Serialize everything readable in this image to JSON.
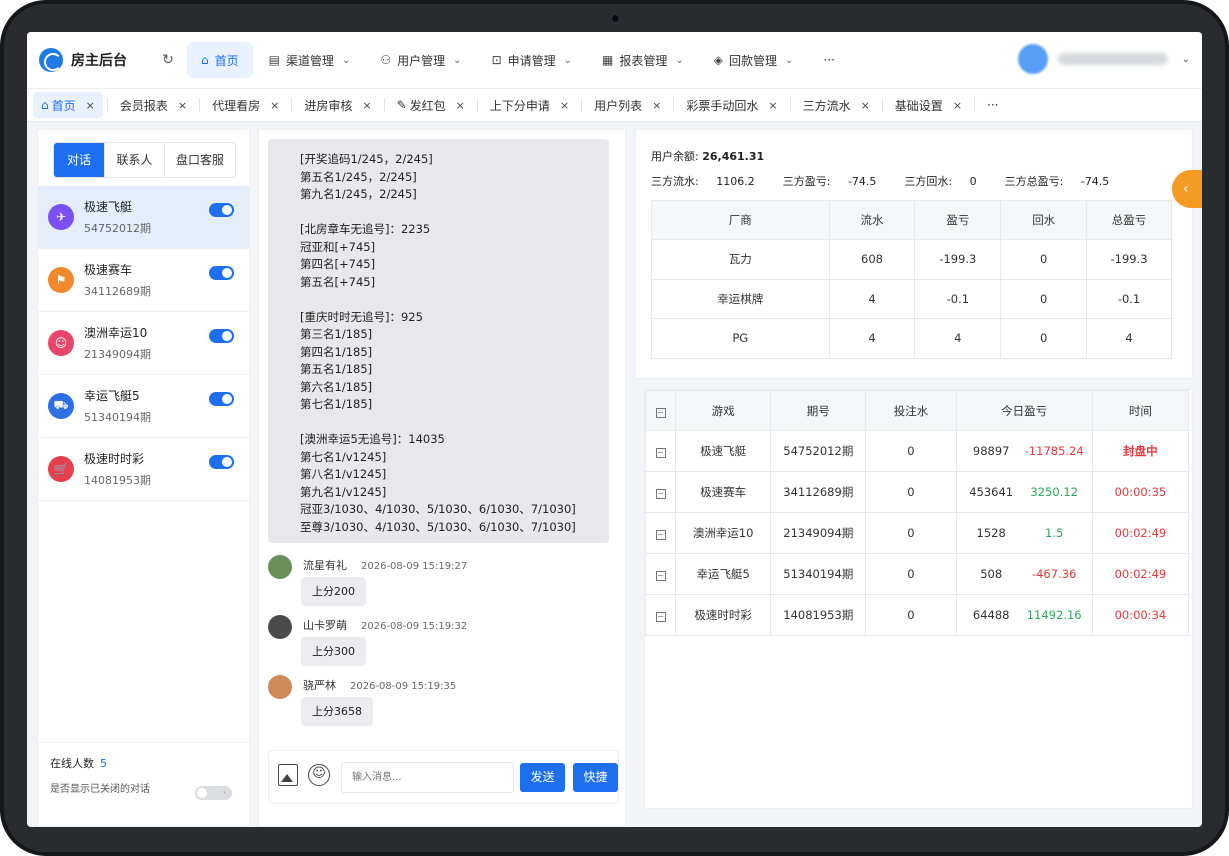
{
  "app": {
    "title": "房主后台",
    "refresh_icon": "refresh-icon"
  },
  "nav": {
    "items": [
      {
        "label": "首页",
        "icon": "home-icon",
        "active": true
      },
      {
        "label": "渠道管理",
        "icon": "channel-icon"
      },
      {
        "label": "用户管理",
        "icon": "users-icon"
      },
      {
        "label": "申请管理",
        "icon": "apply-icon"
      },
      {
        "label": "报表管理",
        "icon": "report-icon"
      },
      {
        "label": "回款管理",
        "icon": "payment-icon"
      }
    ],
    "more": "···"
  },
  "tabs": [
    {
      "label": "首页",
      "active": true
    },
    {
      "label": "会员报表"
    },
    {
      "label": "代理看房"
    },
    {
      "label": "进房审核"
    },
    {
      "label": "发红包"
    },
    {
      "label": "上下分申请"
    },
    {
      "label": "用户列表"
    },
    {
      "label": "彩票手动回水"
    },
    {
      "label": "三方流水"
    },
    {
      "label": "基础设置"
    }
  ],
  "tabs_more": "···",
  "close_glyph": "×",
  "sidebar": {
    "segments": [
      "对话",
      "联系人",
      "盘口客服"
    ],
    "games": [
      {
        "name": "极速飞艇",
        "period": "54752012期",
        "color": "#7b4ff0",
        "icon": "boat-icon",
        "selected": true
      },
      {
        "name": "极速赛车",
        "period": "34112689期",
        "color": "#f0892b",
        "icon": "racecar-icon"
      },
      {
        "name": "澳洲幸运10",
        "period": "21349094期",
        "color": "#e8456b",
        "icon": "person-icon"
      },
      {
        "name": "幸运飞艇5",
        "period": "51340194期",
        "color": "#2f6fe6",
        "icon": "car-icon"
      },
      {
        "name": "极速时时彩",
        "period": "14081953期",
        "color": "#e6404f",
        "icon": "cart-icon"
      }
    ],
    "online_label": "在线人数",
    "online_count": "5",
    "show_closed_label": "是否显示已关闭的对话"
  },
  "chat": {
    "bubble_text": "[开奖追码1/245，2/245]\n第五名1/245，2/245]\n第九名1/245，2/245]\n\n[北房章车无追号]：2235\n冠亚和[+745]\n第四名[+745]\n第五名[+745]\n\n[重庆时时无追号]：925\n第三名1/185]\n第四名1/185]\n第五名1/185]\n第六名1/185]\n第七名1/185]\n\n[澳洲幸运5无追号]：14035\n第七名1/v1245]\n第八名1/v1245]\n第九名1/v1245]\n冠亚3/1030、4/1030、5/1030、6/1030、7/1030]\n至尊3/1030、4/1030、5/1030、6/1030、7/1030]",
    "messages": [
      {
        "name": "流星有礼",
        "time": "2026-08-09 15:19:27",
        "text": "上分200"
      },
      {
        "name": "山卡罗萌",
        "time": "2026-08-09 15:19:32",
        "text": "上分300"
      },
      {
        "name": "骁严林",
        "time": "2026-08-09 15:19:35",
        "text": "上分3658"
      }
    ],
    "input_placeholder": "输入消息...",
    "send_label": "发送",
    "quick_label": "快捷"
  },
  "summary": {
    "balance_label": "用户余额:",
    "balance_value": "26,461.31",
    "stats": [
      {
        "label": "三方流水:",
        "value": "1106.2"
      },
      {
        "label": "三方盈亏:",
        "value": "-74.5"
      },
      {
        "label": "三方回水:",
        "value": "0"
      },
      {
        "label": "三方总盈亏:",
        "value": "-74.5"
      }
    ],
    "vendor_headers": [
      "厂商",
      "流水",
      "盈亏",
      "回水",
      "总盈亏"
    ],
    "vendor_rows": [
      [
        "瓦力",
        "608",
        "-199.3",
        "0",
        "-199.3"
      ],
      [
        "幸运棋牌",
        "4",
        "-0.1",
        "0",
        "-0.1"
      ],
      [
        "PG",
        "4",
        "4",
        "0",
        "4"
      ]
    ]
  },
  "games_table": {
    "headers": [
      "游戏",
      "期号",
      "投注水",
      "今日盈亏",
      "时间"
    ],
    "checkbox_glyph": "−",
    "rows": [
      {
        "game": "极速飞艇",
        "period": "54752012期",
        "bet": "0",
        "a": "98897",
        "b": "-11785.24",
        "b_color": "red",
        "time": "封盘中",
        "time_style": "bold-red"
      },
      {
        "game": "极速赛车",
        "period": "34112689期",
        "bet": "0",
        "a": "453641",
        "b": "3250.12",
        "b_color": "green",
        "time": "00:00:35",
        "time_style": "red"
      },
      {
        "game": "澳洲幸运10",
        "period": "21349094期",
        "bet": "0",
        "a": "1528",
        "b": "1.5",
        "b_color": "green",
        "time": "00:02:49",
        "time_style": "red"
      },
      {
        "game": "幸运飞艇5",
        "period": "51340194期",
        "bet": "0",
        "a": "508",
        "b": "-467.36",
        "b_color": "red",
        "time": "00:02:49",
        "time_style": "red"
      },
      {
        "game": "极速时时彩",
        "period": "14081953期",
        "bet": "0",
        "a": "64488",
        "b": "11492.16",
        "b_color": "green",
        "time": "00:00:34",
        "time_style": "red"
      }
    ]
  },
  "float_button_glyph": "‹"
}
